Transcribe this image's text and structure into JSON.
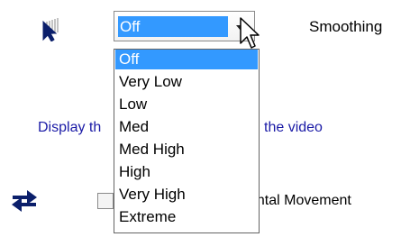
{
  "smoothing": {
    "icon": "cursor-trail-icon",
    "combo_value": "Off",
    "label": "Smoothing",
    "options": [
      "Off",
      "Very Low",
      "Low",
      "Med",
      "Med High",
      "High",
      "Very High",
      "Extreme"
    ],
    "selected_index": 0
  },
  "description": {
    "visible_start": "Display th",
    "visible_end": "the video"
  },
  "horizontal": {
    "icon": "swap-arrows-icon",
    "label_visible": "ontal Movement",
    "checked": false
  },
  "colors": {
    "selection": "#3399ff",
    "description_text": "#1a1aa6",
    "icon_blue": "#0b1f6b"
  }
}
